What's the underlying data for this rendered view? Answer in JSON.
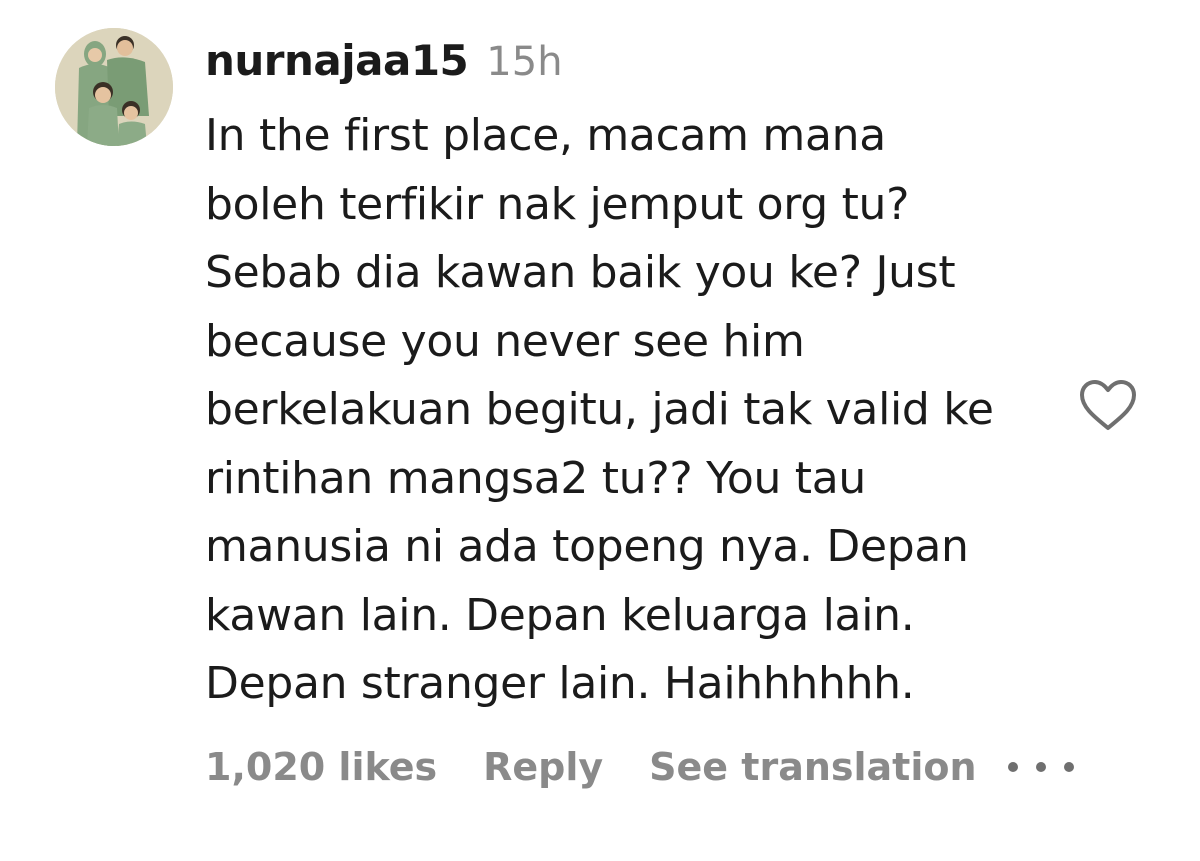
{
  "comment": {
    "avatar_icon": "family-avatar-icon",
    "username": "nurnajaa15",
    "timestamp": "15h",
    "lines": [
      "In the first place, macam mana",
      "boleh terfikir nak jemput org tu?",
      "Sebab dia kawan baik you ke? Just",
      "because you never see him",
      "berkelakuan begitu, jadi tak valid ke",
      "rintihan mangsa2 tu?? You tau",
      "manusia ni ada topeng nya. Depan",
      "kawan lain. Depan keluarga lain.",
      "Depan stranger lain. Haihhhhhh."
    ],
    "like_icon": "heart-outline-icon",
    "more_icon": "more-options-icon"
  },
  "footer": {
    "likes": "1,020 likes",
    "reply": "Reply",
    "see_translation": "See translation"
  },
  "colors": {
    "text_primary": "#1b1b1b",
    "text_secondary": "#8a8a8a",
    "icon": "#6f6f6f",
    "avatar_background": "#d9d2b8",
    "avatar_clothing": "#7fa07a"
  }
}
